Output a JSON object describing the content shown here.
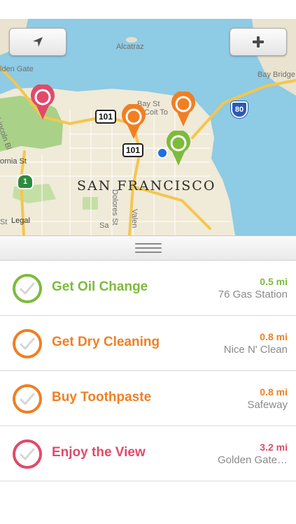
{
  "map": {
    "labels": {
      "alcatraz": "Alcatraz",
      "golden_gate": "lden Gate",
      "bay_bridge": "Bay Bridge",
      "bay_st": "Bay St",
      "coit_tower": "Coit To",
      "hwy_101_a": "101",
      "hwy_101_b": "101",
      "hwy_80": "80",
      "hwy_1": "1",
      "lincoln": "Lincoln Bl",
      "fornia_st": "ornia St",
      "st_left": "St",
      "valencia": "Valen",
      "dolores": "Dolores St",
      "sa": "Sa",
      "city": "SAN FRANCISCO",
      "legal": "Legal"
    },
    "buttons": {
      "locate_icon": "location-arrow-icon",
      "add_icon": "plus-icon"
    },
    "colors": {
      "water": "#8ecbe4",
      "land": "#f0ead8",
      "park": "#a9d187",
      "highway": "#f4c64d"
    }
  },
  "colors": {
    "green": "#7dbb3c",
    "orange": "#f07f23",
    "pink": "#e04a6a"
  },
  "tasks": [
    {
      "title": "Get Oil Change",
      "distance": "0.5 mi",
      "place": "76 Gas Station",
      "color": "#7dbb3c"
    },
    {
      "title": "Get Dry Cleaning",
      "distance": "0.8 mi",
      "place": "Nice N' Clean",
      "color": "#f07f23"
    },
    {
      "title": "Buy Toothpaste",
      "distance": "0.8 mi",
      "place": "Safeway",
      "color": "#f07f23"
    },
    {
      "title": "Enjoy the View",
      "distance": "3.2 mi",
      "place": "Golden Gate…",
      "color": "#e04a6a"
    }
  ]
}
